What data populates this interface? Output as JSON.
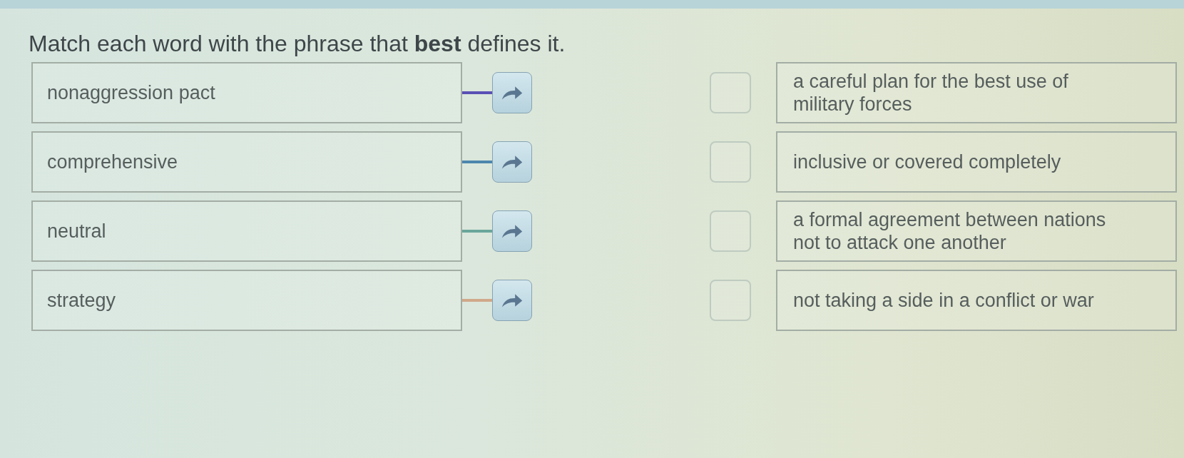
{
  "instruction": "Match each word with the phrase that **best** defines it.",
  "terms": [
    {
      "text": "nonaggression pact",
      "color": "#5a4fb5"
    },
    {
      "text": "comprehensive",
      "color": "#4d86ad"
    },
    {
      "text": "neutral",
      "color": "#6aa69a"
    },
    {
      "text": "strategy",
      "color": "#d0a88a"
    }
  ],
  "definitions": [
    {
      "text": "a careful plan for the best use of military forces"
    },
    {
      "text": "inclusive or covered completely"
    },
    {
      "text": "a formal agreement between nations not to attack one another"
    },
    {
      "text": "not taking a side in a conflict or war"
    }
  ]
}
